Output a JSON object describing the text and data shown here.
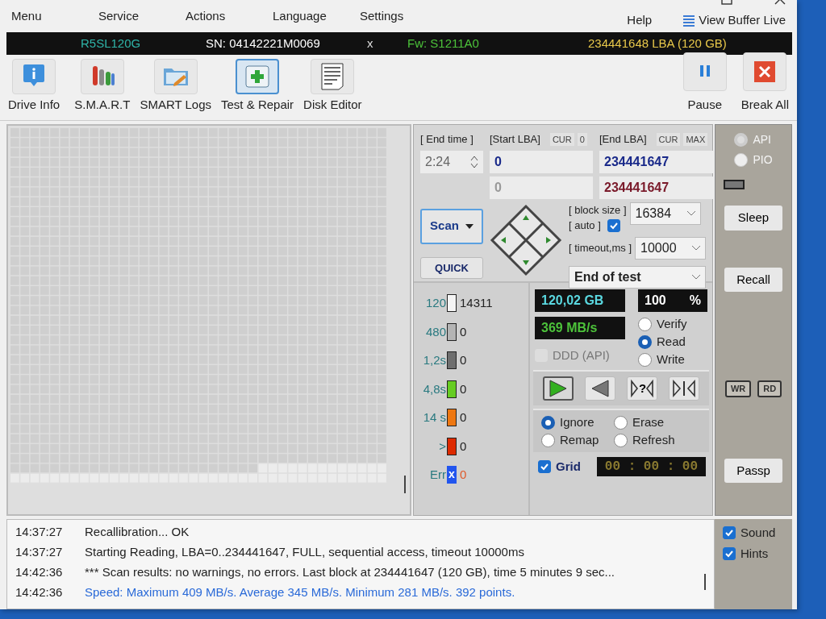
{
  "menu": {
    "items": [
      "Menu",
      "Service",
      "Actions",
      "Language",
      "Settings"
    ],
    "help": "Help",
    "view_buffer": "View Buffer Live"
  },
  "drive_bar": {
    "model": "R5SL120G",
    "serial": "SN: 04142221M0069",
    "close": "x",
    "firmware": "Fw: S1211A0",
    "capacity": "234441648 LBA (120 GB)"
  },
  "toolbar": {
    "tools": [
      {
        "kind": "info",
        "label": "Drive Info",
        "selected": false
      },
      {
        "kind": "smart",
        "label": "S.M.A.R.T",
        "selected": false
      },
      {
        "kind": "logs",
        "label": "SMART Logs",
        "selected": false
      },
      {
        "kind": "repair",
        "label": "Test & Repair",
        "selected": true
      },
      {
        "kind": "editor",
        "label": "Disk Editor",
        "selected": false
      }
    ],
    "actions": [
      {
        "kind": "pause",
        "label": "Pause"
      },
      {
        "kind": "break",
        "label": "Break All"
      }
    ]
  },
  "scan_settings": {
    "end_time_label": "[ End time ]",
    "end_time": "2:24",
    "start_lba_label": "[Start LBA]",
    "start_cur": "CUR",
    "start_zero": "0",
    "end_lba_label": "[End LBA]",
    "end_cur": "CUR",
    "end_max": "MAX",
    "start_lba": "0",
    "start_lba_current": "0",
    "end_lba": "234441647",
    "end_lba_current": "234441647",
    "scan_button": "Scan",
    "quick_button": "QUICK",
    "block_size_label": "[ block size ]",
    "auto_label": "[ auto ]",
    "auto_checked": true,
    "block_size": "16384",
    "timeout_label": "[ timeout,ms ]",
    "timeout": "10000",
    "end_action": "End of test"
  },
  "legend": [
    {
      "label": "120",
      "count": "14311",
      "color": "#f4f4f4"
    },
    {
      "label": "480",
      "count": "0",
      "color": "#b4b4b4"
    },
    {
      "label": "1,2s",
      "count": "0",
      "color": "#6e6e6e"
    },
    {
      "label": "4,8s",
      "count": "0",
      "color": "#66cc22"
    },
    {
      "label": "14 s",
      "count": "0",
      "color": "#ee7711"
    },
    {
      "label": ">",
      "count": "0",
      "color": "#dd2a00"
    },
    {
      "label": "Err",
      "count": "0",
      "color": "#2255ee",
      "mark": "x"
    }
  ],
  "readouts": {
    "capacity": "120,02 GB",
    "percent": "100",
    "percent_sign": "%",
    "speed": "369 MB/s"
  },
  "ddd": {
    "label": "DDD (API)",
    "checked": false,
    "disabled": true
  },
  "modes": [
    {
      "label": "Verify",
      "selected": false
    },
    {
      "label": "Read",
      "selected": true
    },
    {
      "label": "Write",
      "selected": false
    }
  ],
  "transport": [
    {
      "kind": "forward",
      "selected": true
    },
    {
      "kind": "backward",
      "selected": false
    },
    {
      "kind": "random",
      "label": "?",
      "selected": false
    },
    {
      "kind": "butterfly",
      "selected": false
    }
  ],
  "error_actions": [
    {
      "label": "Ignore",
      "selected": true
    },
    {
      "label": "Erase",
      "selected": false
    },
    {
      "label": "Remap",
      "selected": false
    },
    {
      "label": "Refresh",
      "selected": false
    }
  ],
  "grid_option": {
    "label": "Grid",
    "checked": true
  },
  "timer": "00 : 00 : 00",
  "sidebar": {
    "interfaces": [
      {
        "label": "API",
        "selected": true
      },
      {
        "label": "PIO",
        "selected": false
      }
    ],
    "buttons": [
      "Sleep",
      "Recall"
    ],
    "indicators": [
      "WR",
      "RD"
    ],
    "passp": "Passp"
  },
  "log": [
    {
      "time": "14:37:27",
      "text": "Recallibration... OK",
      "kind": "info"
    },
    {
      "time": "14:37:27",
      "text": "Starting Reading, LBA=0..234441647, FULL, sequential access, timeout 10000ms",
      "kind": "info"
    },
    {
      "time": "14:42:36",
      "text": "*** Scan results: no warnings, no errors. Last block at 234441647 (120 GB), time 5 minutes 9 sec...",
      "kind": "info"
    },
    {
      "time": "14:42:36",
      "text": "Speed: Maximum 409 MB/s. Average 345 MB/s. Minimum 281 MB/s. 392 points.",
      "kind": "speed"
    }
  ],
  "log_options": [
    {
      "label": "Sound",
      "checked": true
    },
    {
      "label": "Hints",
      "checked": true
    }
  ]
}
